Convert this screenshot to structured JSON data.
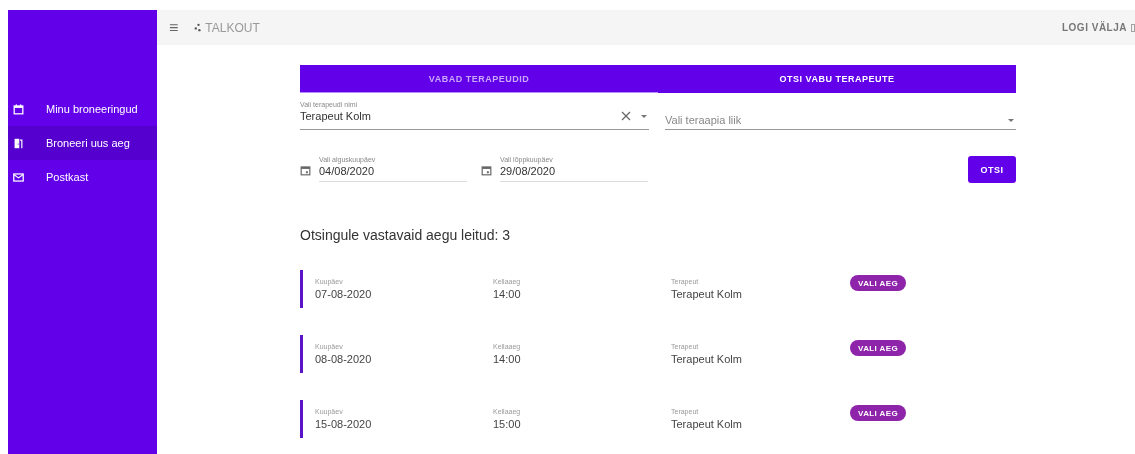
{
  "sidebar": {
    "items": [
      {
        "label": "Minu broneeringud",
        "kind": "calendar",
        "selected": false
      },
      {
        "label": "Broneeri uus aeg",
        "kind": "booking",
        "selected": true
      },
      {
        "label": "Postkast",
        "kind": "mail",
        "selected": false
      }
    ]
  },
  "topbar": {
    "menu_icon": "≡",
    "brand": "TALKOUT",
    "logout": "LOGI VÄLJA"
  },
  "tabs": [
    {
      "label": "VABAD TERAPEUDID",
      "selected": false
    },
    {
      "label": "OTSI VABU TERAPEUTE",
      "selected": true
    }
  ],
  "therapist_field": {
    "label": "Vali terapeudi nimi",
    "value": "Terapeut Kolm"
  },
  "therapy_field": {
    "placeholder": "Vali teraapia liik"
  },
  "start_date": {
    "label": "Vali alguskuupäev",
    "value": "04/08/2020"
  },
  "end_date": {
    "label": "Vali lõppkuupäev",
    "value": "29/08/2020"
  },
  "search_button": "OTSI",
  "results_heading": "Otsingule vastavaid aegu leitud: 3",
  "results": [
    {
      "date_label": "Kuupäev",
      "date": "07-08-2020",
      "time_label": "Kellaaeg",
      "time": "14:00",
      "therapist_label": "Terapeut",
      "therapist": "Terapeut Kolm",
      "button": "VALI AEG"
    },
    {
      "date_label": "Kuupäev",
      "date": "08-08-2020",
      "time_label": "Kellaaeg",
      "time": "14:00",
      "therapist_label": "Terapeut",
      "therapist": "Terapeut Kolm",
      "button": "VALI AEG"
    },
    {
      "date_label": "Kuupäev",
      "date": "15-08-2020",
      "time_label": "Kellaaeg",
      "time": "15:00",
      "therapist_label": "Terapeut",
      "therapist": "Terapeut Kolm",
      "button": "VALI AEG"
    }
  ]
}
